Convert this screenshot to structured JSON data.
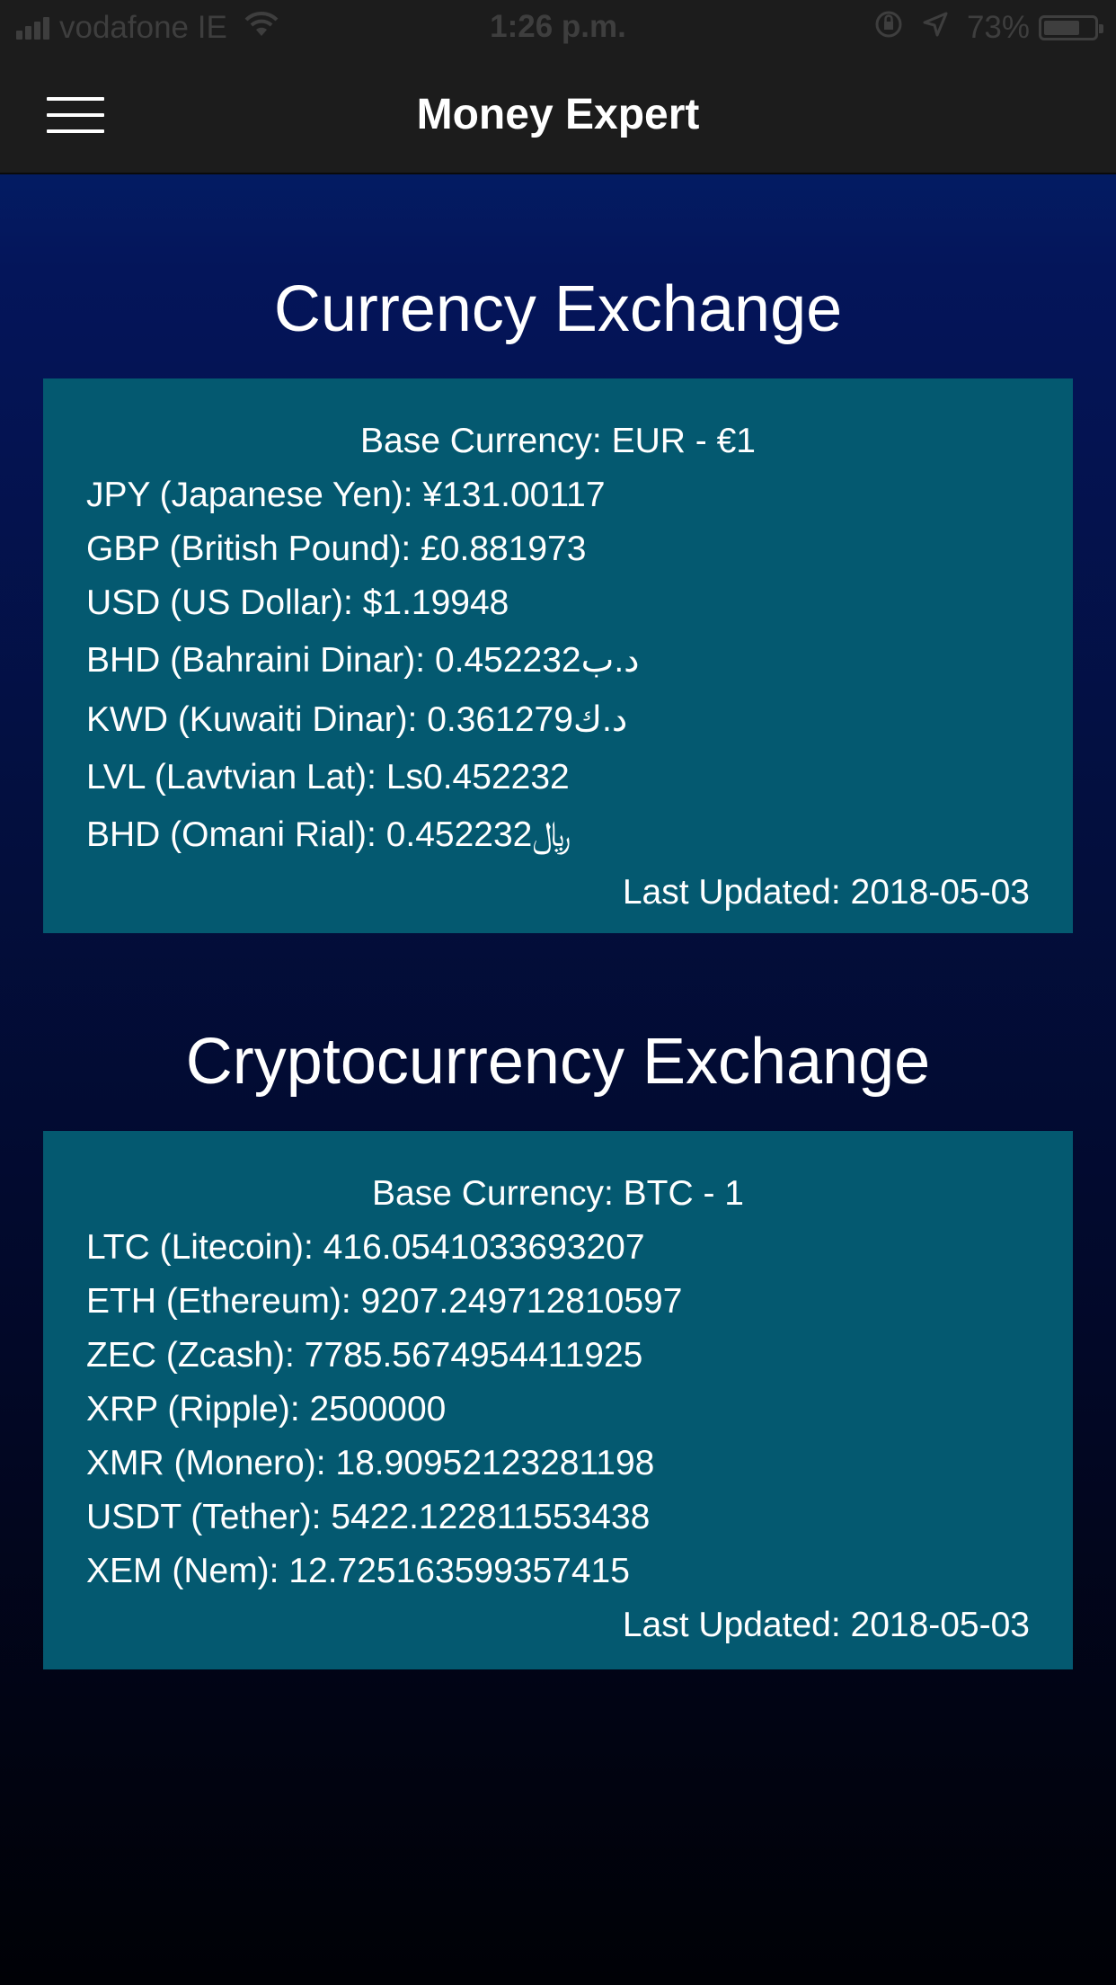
{
  "status_bar": {
    "carrier": "vodafone IE",
    "time": "1:26 p.m.",
    "battery": "73%",
    "battery_level": 0.73
  },
  "header": {
    "title": "Money Expert"
  },
  "currency": {
    "title": "Currency Exchange",
    "base": "Base Currency: EUR - €1",
    "rates": [
      "JPY (Japanese Yen): ¥131.00117",
      "GBP (British Pound): £0.881973",
      "USD (US Dollar): $1.19948",
      "BHD (Bahraini Dinar): 0.452232د.ب",
      "KWD (Kuwaiti Dinar): 0.361279د.ك",
      "LVL (Lavtvian Lat): Ls0.452232",
      "BHD (Omani Rial): 0.452232﷼"
    ],
    "updated": "Last Updated: 2018-05-03"
  },
  "crypto": {
    "title": "Cryptocurrency Exchange",
    "base": "Base Currency: BTC - 1",
    "rates": [
      "LTC (Litecoin): 416.0541033693207",
      "ETH (Ethereum): 9207.249712810597",
      "ZEC (Zcash): 7785.5674954411925",
      "XRP (Ripple): 2500000",
      "XMR (Monero): 18.90952123281198",
      "USDT (Tether): 5422.122811553438",
      "XEM (Nem): 12.725163599357415"
    ],
    "updated": "Last Updated: 2018-05-03"
  }
}
